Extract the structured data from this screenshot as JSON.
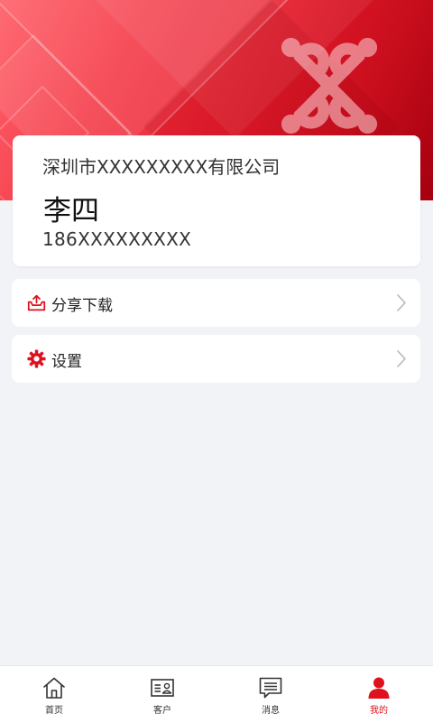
{
  "profile": {
    "company": "深圳市XXXXXXXXX有限公司",
    "name": "李四",
    "phone": "186XXXXXXXXX"
  },
  "menu": {
    "share_download": "分享下载",
    "settings": "设置"
  },
  "bottom_nav": [
    {
      "label": "首页",
      "icon": "home-icon"
    },
    {
      "label": "客户",
      "icon": "customer-card-icon"
    },
    {
      "label": "消息",
      "icon": "message-icon"
    },
    {
      "label": "我的",
      "icon": "person-icon",
      "active": true
    }
  ],
  "colors": {
    "accent": "#e0101e",
    "banner_red": "#e41b2b",
    "background": "#f2f3f7"
  }
}
